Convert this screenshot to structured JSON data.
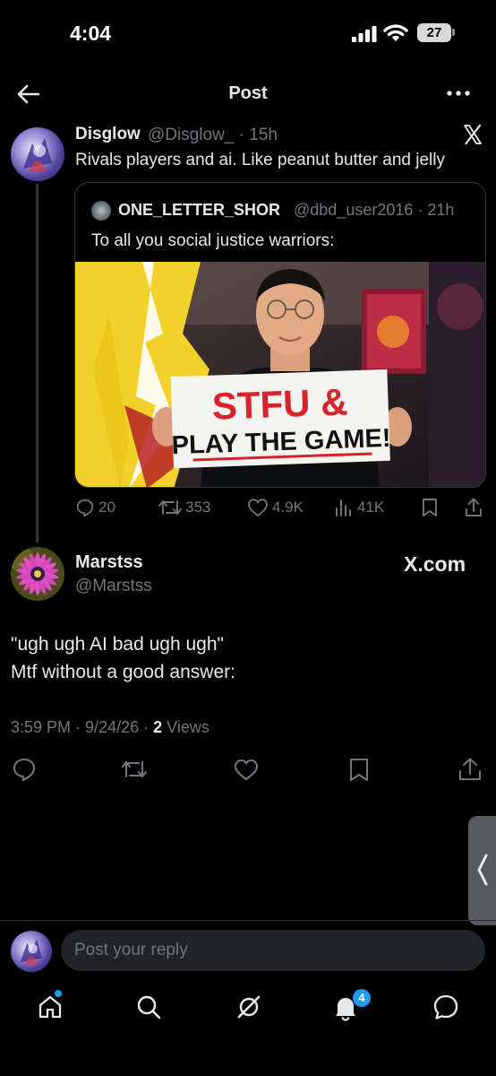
{
  "status_bar": {
    "time": "4:04",
    "battery": "27"
  },
  "header": {
    "title": "Post"
  },
  "parent_post": {
    "name": "Disglow",
    "handle": "@Disglow_",
    "age": "15h",
    "text": "Rivals players and ai. Like peanut butter and jelly",
    "quote": {
      "name": "ONE_LETTER_SHOR",
      "handle": "@dbd_user2016",
      "age": "21h",
      "text": "To all you social justice warriors:",
      "sign_line1": "STFU &",
      "sign_line2": "PLAY THE GAME!"
    },
    "actions": {
      "replies": "20",
      "reposts": "353",
      "likes": "4.9K",
      "views": "41K"
    }
  },
  "main_post": {
    "name": "Marstss",
    "handle": "@Marstss",
    "watermark": "X.com",
    "line1": "\"ugh ugh AI bad ugh ugh\"",
    "line2": "Mtf without a good answer:",
    "time": "3:59 PM",
    "date": "9/24/26",
    "views_count": "2",
    "views_label": "Views"
  },
  "reply": {
    "placeholder": "Post your reply"
  },
  "nav": {
    "notifications_badge": "4"
  },
  "colors": {
    "accent": "#1d9bf0",
    "muted": "#71767b",
    "text": "#e7e9ea",
    "sign_red": "#d8232a"
  },
  "icons": [
    "back-arrow-icon",
    "more-dots-icon",
    "x-logo-icon",
    "reply-icon",
    "repost-icon",
    "like-icon",
    "views-icon",
    "bookmark-icon",
    "share-icon",
    "home-icon",
    "search-icon",
    "grok-icon",
    "bell-icon",
    "messages-icon",
    "chevron-left-icon"
  ]
}
